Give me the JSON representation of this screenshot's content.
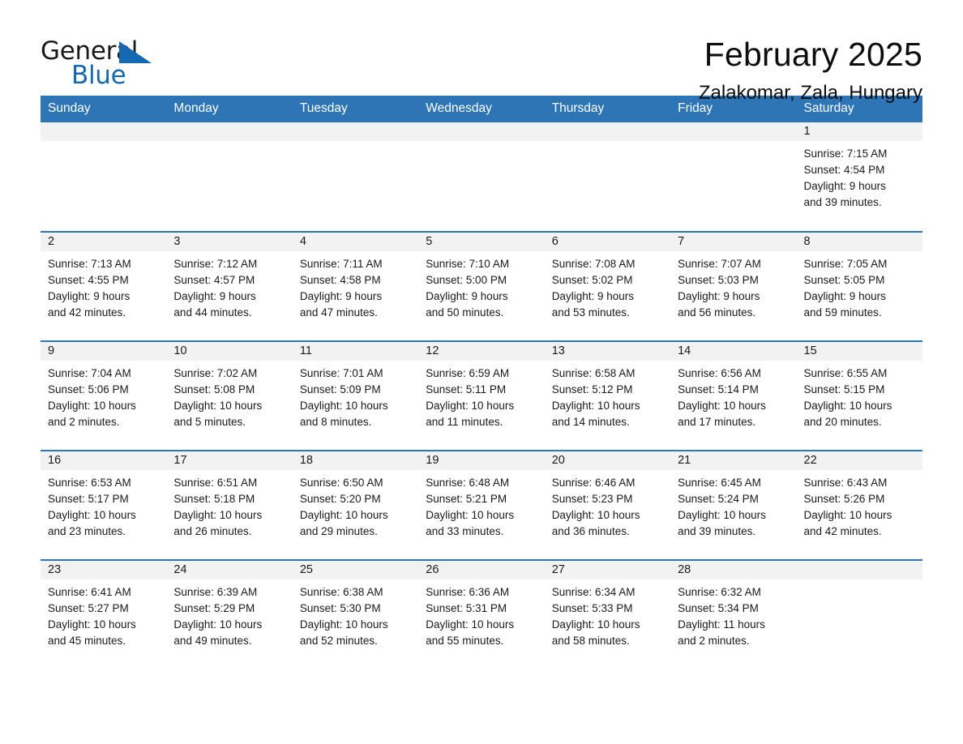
{
  "logo": {
    "word_one": "General",
    "word_two": "Blue",
    "triangle_color": "#1569b0"
  },
  "header": {
    "month_title": "February 2025",
    "location": "Zalakomar, Zala, Hungary"
  },
  "theme": {
    "header_blue": "#2e75b6",
    "daynum_gray": "#f2f2f2",
    "text": "#1a1a1a"
  },
  "calendar": {
    "weekday_headers": [
      "Sunday",
      "Monday",
      "Tuesday",
      "Wednesday",
      "Thursday",
      "Friday",
      "Saturday"
    ],
    "weeks": [
      [
        {
          "day": "",
          "lines": []
        },
        {
          "day": "",
          "lines": []
        },
        {
          "day": "",
          "lines": []
        },
        {
          "day": "",
          "lines": []
        },
        {
          "day": "",
          "lines": []
        },
        {
          "day": "",
          "lines": []
        },
        {
          "day": "1",
          "lines": [
            "Sunrise: 7:15 AM",
            "Sunset: 4:54 PM",
            "Daylight: 9 hours",
            "and 39 minutes."
          ]
        }
      ],
      [
        {
          "day": "2",
          "lines": [
            "Sunrise: 7:13 AM",
            "Sunset: 4:55 PM",
            "Daylight: 9 hours",
            "and 42 minutes."
          ]
        },
        {
          "day": "3",
          "lines": [
            "Sunrise: 7:12 AM",
            "Sunset: 4:57 PM",
            "Daylight: 9 hours",
            "and 44 minutes."
          ]
        },
        {
          "day": "4",
          "lines": [
            "Sunrise: 7:11 AM",
            "Sunset: 4:58 PM",
            "Daylight: 9 hours",
            "and 47 minutes."
          ]
        },
        {
          "day": "5",
          "lines": [
            "Sunrise: 7:10 AM",
            "Sunset: 5:00 PM",
            "Daylight: 9 hours",
            "and 50 minutes."
          ]
        },
        {
          "day": "6",
          "lines": [
            "Sunrise: 7:08 AM",
            "Sunset: 5:02 PM",
            "Daylight: 9 hours",
            "and 53 minutes."
          ]
        },
        {
          "day": "7",
          "lines": [
            "Sunrise: 7:07 AM",
            "Sunset: 5:03 PM",
            "Daylight: 9 hours",
            "and 56 minutes."
          ]
        },
        {
          "day": "8",
          "lines": [
            "Sunrise: 7:05 AM",
            "Sunset: 5:05 PM",
            "Daylight: 9 hours",
            "and 59 minutes."
          ]
        }
      ],
      [
        {
          "day": "9",
          "lines": [
            "Sunrise: 7:04 AM",
            "Sunset: 5:06 PM",
            "Daylight: 10 hours",
            "and 2 minutes."
          ]
        },
        {
          "day": "10",
          "lines": [
            "Sunrise: 7:02 AM",
            "Sunset: 5:08 PM",
            "Daylight: 10 hours",
            "and 5 minutes."
          ]
        },
        {
          "day": "11",
          "lines": [
            "Sunrise: 7:01 AM",
            "Sunset: 5:09 PM",
            "Daylight: 10 hours",
            "and 8 minutes."
          ]
        },
        {
          "day": "12",
          "lines": [
            "Sunrise: 6:59 AM",
            "Sunset: 5:11 PM",
            "Daylight: 10 hours",
            "and 11 minutes."
          ]
        },
        {
          "day": "13",
          "lines": [
            "Sunrise: 6:58 AM",
            "Sunset: 5:12 PM",
            "Daylight: 10 hours",
            "and 14 minutes."
          ]
        },
        {
          "day": "14",
          "lines": [
            "Sunrise: 6:56 AM",
            "Sunset: 5:14 PM",
            "Daylight: 10 hours",
            "and 17 minutes."
          ]
        },
        {
          "day": "15",
          "lines": [
            "Sunrise: 6:55 AM",
            "Sunset: 5:15 PM",
            "Daylight: 10 hours",
            "and 20 minutes."
          ]
        }
      ],
      [
        {
          "day": "16",
          "lines": [
            "Sunrise: 6:53 AM",
            "Sunset: 5:17 PM",
            "Daylight: 10 hours",
            "and 23 minutes."
          ]
        },
        {
          "day": "17",
          "lines": [
            "Sunrise: 6:51 AM",
            "Sunset: 5:18 PM",
            "Daylight: 10 hours",
            "and 26 minutes."
          ]
        },
        {
          "day": "18",
          "lines": [
            "Sunrise: 6:50 AM",
            "Sunset: 5:20 PM",
            "Daylight: 10 hours",
            "and 29 minutes."
          ]
        },
        {
          "day": "19",
          "lines": [
            "Sunrise: 6:48 AM",
            "Sunset: 5:21 PM",
            "Daylight: 10 hours",
            "and 33 minutes."
          ]
        },
        {
          "day": "20",
          "lines": [
            "Sunrise: 6:46 AM",
            "Sunset: 5:23 PM",
            "Daylight: 10 hours",
            "and 36 minutes."
          ]
        },
        {
          "day": "21",
          "lines": [
            "Sunrise: 6:45 AM",
            "Sunset: 5:24 PM",
            "Daylight: 10 hours",
            "and 39 minutes."
          ]
        },
        {
          "day": "22",
          "lines": [
            "Sunrise: 6:43 AM",
            "Sunset: 5:26 PM",
            "Daylight: 10 hours",
            "and 42 minutes."
          ]
        }
      ],
      [
        {
          "day": "23",
          "lines": [
            "Sunrise: 6:41 AM",
            "Sunset: 5:27 PM",
            "Daylight: 10 hours",
            "and 45 minutes."
          ]
        },
        {
          "day": "24",
          "lines": [
            "Sunrise: 6:39 AM",
            "Sunset: 5:29 PM",
            "Daylight: 10 hours",
            "and 49 minutes."
          ]
        },
        {
          "day": "25",
          "lines": [
            "Sunrise: 6:38 AM",
            "Sunset: 5:30 PM",
            "Daylight: 10 hours",
            "and 52 minutes."
          ]
        },
        {
          "day": "26",
          "lines": [
            "Sunrise: 6:36 AM",
            "Sunset: 5:31 PM",
            "Daylight: 10 hours",
            "and 55 minutes."
          ]
        },
        {
          "day": "27",
          "lines": [
            "Sunrise: 6:34 AM",
            "Sunset: 5:33 PM",
            "Daylight: 10 hours",
            "and 58 minutes."
          ]
        },
        {
          "day": "28",
          "lines": [
            "Sunrise: 6:32 AM",
            "Sunset: 5:34 PM",
            "Daylight: 11 hours",
            "and 2 minutes."
          ]
        },
        {
          "day": "",
          "lines": []
        }
      ]
    ]
  }
}
